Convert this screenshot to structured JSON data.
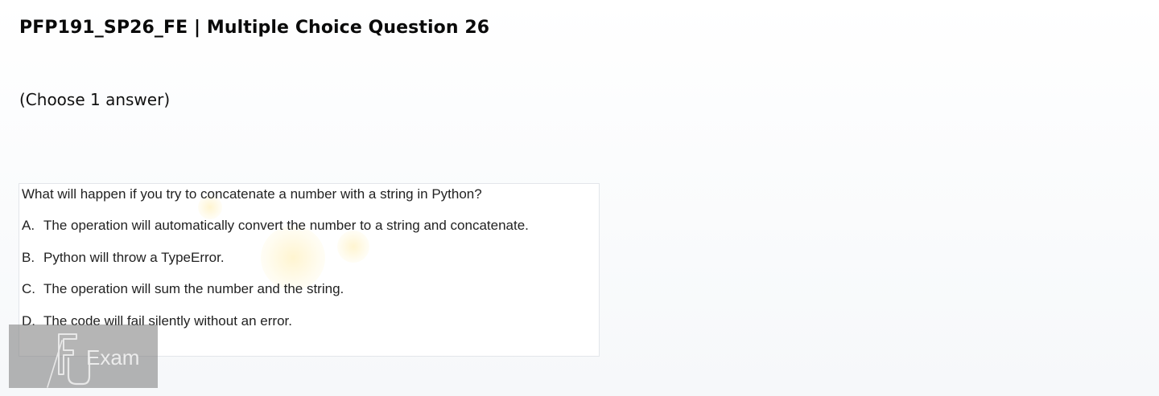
{
  "header": {
    "title": "PFP191_SP26_FE | Multiple Choice Question 26"
  },
  "instruction": "(Choose 1 answer)",
  "question": {
    "text": "What will happen if you try to concatenate a number with a string in Python?",
    "options": [
      {
        "letter": "A.",
        "text": "The operation will automatically convert the number to a string and concatenate."
      },
      {
        "letter": "B.",
        "text": "Python will throw a TypeError."
      },
      {
        "letter": "C.",
        "text": "The operation will sum the number and the string."
      },
      {
        "letter": "D.",
        "text": "The code will fail silently without an error."
      }
    ]
  },
  "watermark": {
    "logo_text": "Exam"
  },
  "colors": {
    "title": "#0a0a0a",
    "question_border": "#e3e6ea",
    "watermark_bg": "#787878"
  }
}
